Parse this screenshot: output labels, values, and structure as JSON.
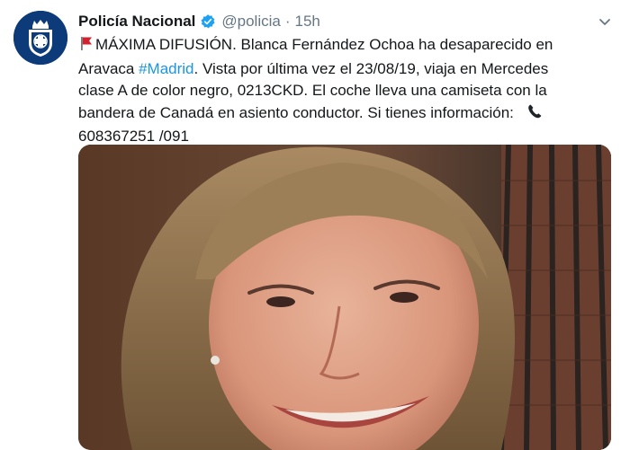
{
  "tweet": {
    "author_name": "Policía Nacional",
    "handle": "@policia",
    "separator": "·",
    "time": "15h",
    "text": {
      "l1": "MÁXIMA DIFUSIÓN. Blanca Fernández Ochoa ha desaparecido en",
      "l2_a": "Aravaca ",
      "hashtag": "#Madrid",
      "l2_b": ". Vista por última vez el 23/08/19, viaja en Mercedes",
      "l3": "clase A de color negro, 0213CKD. El coche lleva una camiseta con la",
      "l4": "bandera de Canadá en asiento conductor. Si tienes información:",
      "l5": "608367251 /091"
    },
    "icons": {
      "flag": "red-flag-icon",
      "phone": "telephone-icon",
      "verified": "verified-badge-icon",
      "menu": "chevron-down-icon"
    }
  },
  "colors": {
    "link": "#1b95e0",
    "secondary": "#657786",
    "verified": "#1da1f2",
    "avatar_bg": "#0d3b7a"
  }
}
